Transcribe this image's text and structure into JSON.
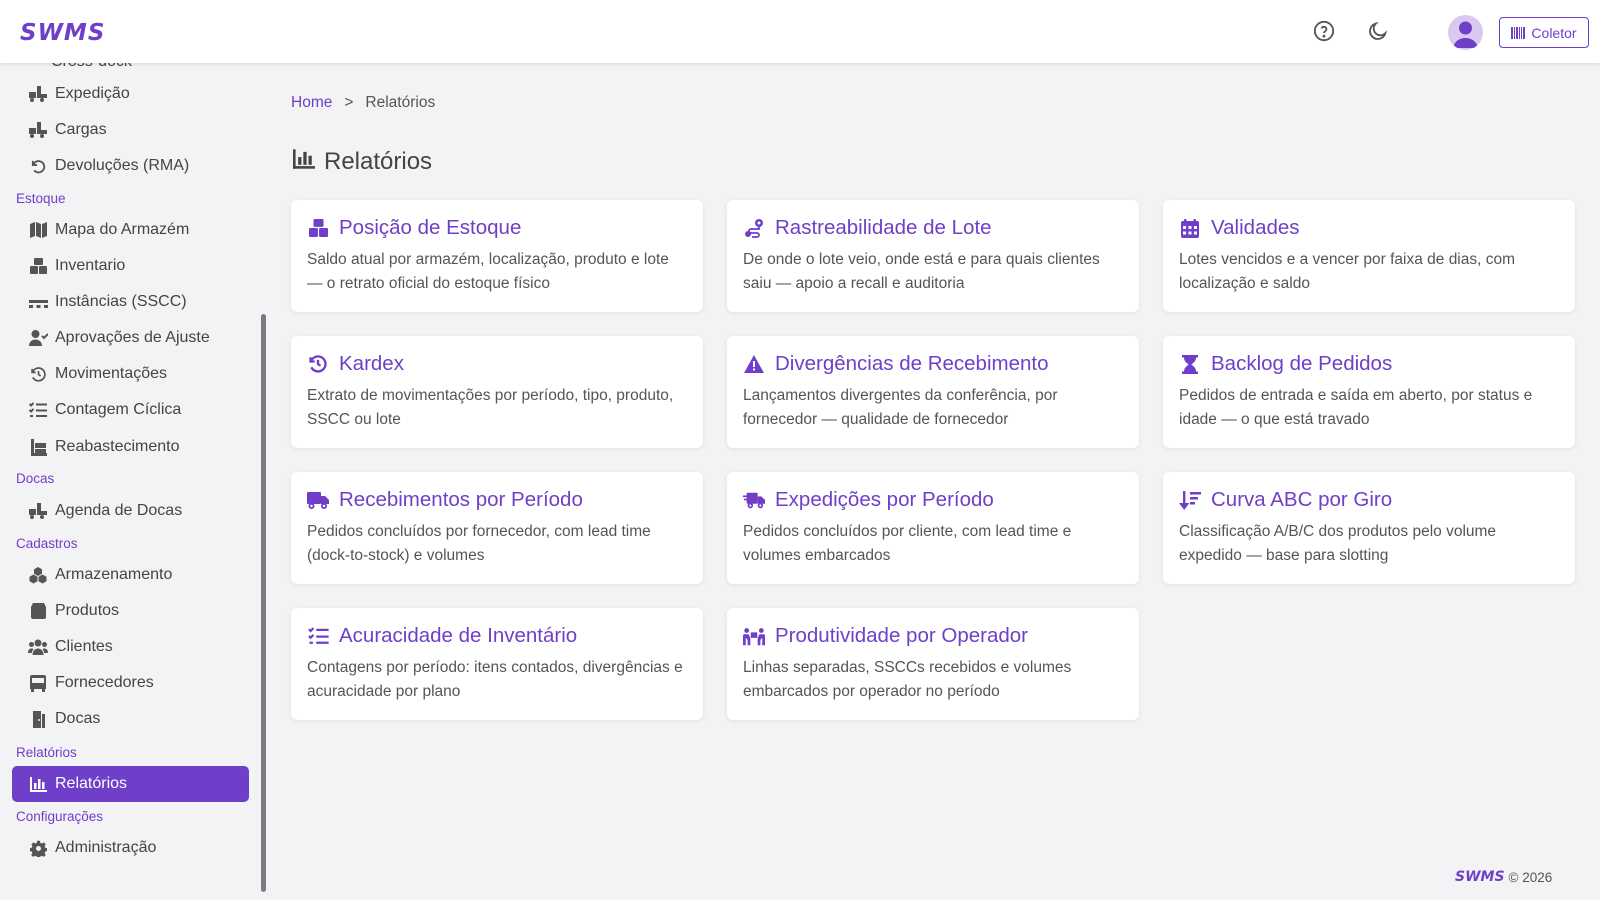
{
  "brand": {
    "name": "SWMS",
    "color": "#6f3fc9"
  },
  "header": {
    "icons": [
      "help-circle-icon",
      "moon-icon",
      "user-avatar-icon"
    ],
    "coletor_label": "Coletor"
  },
  "sidebar": {
    "items": [
      {
        "label": "Expedição",
        "icon": "truck-loading-icon"
      },
      {
        "label": "Cargas",
        "icon": "truck-loading-icon"
      },
      {
        "label": "Devoluções (RMA)",
        "icon": "undo-icon"
      },
      {
        "section": "Estoque"
      },
      {
        "label": "Mapa do Armazém",
        "icon": "map-icon"
      },
      {
        "label": "Inventario",
        "icon": "boxes-icon"
      },
      {
        "label": "Instâncias (SSCC)",
        "icon": "pallet-icon"
      },
      {
        "label": "Aprovações de Ajuste",
        "icon": "user-check-icon"
      },
      {
        "label": "Movimentações",
        "icon": "history-icon"
      },
      {
        "label": "Contagem Cíclica",
        "icon": "list-check-icon"
      },
      {
        "label": "Reabastecimento",
        "icon": "dolly-icon"
      },
      {
        "section": "Docas"
      },
      {
        "label": "Agenda de Docas",
        "icon": "truck-loading-icon"
      },
      {
        "section": "Cadastros"
      },
      {
        "label": "Armazenamento",
        "icon": "cubes-icon"
      },
      {
        "label": "Produtos",
        "icon": "box-icon"
      },
      {
        "label": "Clientes",
        "icon": "users-icon"
      },
      {
        "label": "Fornecedores",
        "icon": "bus-icon"
      },
      {
        "label": "Docas",
        "icon": "door-icon"
      },
      {
        "section": "Relatórios"
      },
      {
        "label": "Relatórios",
        "icon": "chart-bar-icon",
        "active": true
      },
      {
        "section": "Configurações"
      },
      {
        "label": "Administração",
        "icon": "gear-icon"
      }
    ]
  },
  "breadcrumb": {
    "home": "Home",
    "separator": ">",
    "current": "Relatórios"
  },
  "page": {
    "title": "Relatórios",
    "icon": "chart-bar-icon"
  },
  "reports": [
    {
      "title": "Posição de Estoque",
      "icon": "boxes-icon",
      "desc": "Saldo atual por armazém, localização, produto e lote — o retrato oficial do estoque físico"
    },
    {
      "title": "Rastreabilidade de Lote",
      "icon": "route-icon",
      "desc": "De onde o lote veio, onde está e para quais clientes saiu — apoio a recall e auditoria"
    },
    {
      "title": "Validades",
      "icon": "calendar-icon",
      "desc": "Lotes vencidos e a vencer por faixa de dias, com localização e saldo"
    },
    {
      "title": "Kardex",
      "icon": "history-icon",
      "desc": "Extrato de movimentações por período, tipo, produto, SSCC ou lote"
    },
    {
      "title": "Divergências de Recebimento",
      "icon": "warning-icon",
      "desc": "Lançamentos divergentes da conferência, por fornecedor — qualidade de fornecedor"
    },
    {
      "title": "Backlog de Pedidos",
      "icon": "hourglass-icon",
      "desc": "Pedidos de entrada e saída em aberto, por status e idade — o que está travado"
    },
    {
      "title": "Recebimentos por Período",
      "icon": "truck-icon",
      "desc": "Pedidos concluídos por fornecedor, com lead time (dock-to-stock) e volumes"
    },
    {
      "title": "Expedições por Período",
      "icon": "truck-fast-icon",
      "desc": "Pedidos concluídos por cliente, com lead time e volumes embarcados"
    },
    {
      "title": "Curva ABC por Giro",
      "icon": "sort-down-icon",
      "desc": "Classificação A/B/C dos produtos pelo volume expedido — base para slotting"
    },
    {
      "title": "Acuracidade de Inventário",
      "icon": "list-check-icon",
      "desc": "Contagens por período: itens contados, divergências e acuracidade por plano"
    },
    {
      "title": "Produtividade por Operador",
      "icon": "people-carry-icon",
      "desc": "Linhas separadas, SSCCs recebidos e volumes embarcados por operador no período"
    }
  ],
  "footer": {
    "brand": "SWMS",
    "copyright": "© 2026"
  }
}
